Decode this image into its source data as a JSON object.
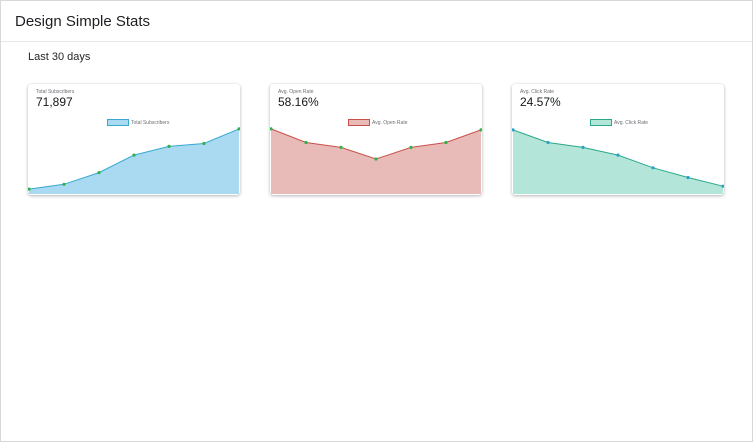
{
  "header": {
    "title": "Design Simple Stats"
  },
  "range_label": "Last 30 days",
  "cards": [
    {
      "label": "Total Subscribers",
      "value": "71,897",
      "legend": "Total Subscribers",
      "fill": "#a9daf2",
      "stroke": "#38a8cf",
      "point": "#2db34a"
    },
    {
      "label": "Avg. Open Rate",
      "value": "58.16%",
      "legend": "Avg. Open Rate",
      "fill": "#e9bbb8",
      "stroke": "#c9504a",
      "point": "#2db34a"
    },
    {
      "label": "Avg. Click Rate",
      "value": "24.57%",
      "legend": "Avg. Click Rate",
      "fill": "#b3e5d9",
      "stroke": "#2aa88b",
      "point": "#2aa1c8"
    }
  ],
  "chart_data": [
    {
      "type": "area",
      "series": [
        {
          "name": "Total Subscribers",
          "values": [
            5,
            10,
            22,
            40,
            49,
            52,
            67
          ]
        }
      ]
    },
    {
      "type": "area",
      "series": [
        {
          "name": "Avg. Open Rate",
          "values": [
            67,
            53,
            48,
            36,
            48,
            53,
            66
          ]
        }
      ]
    },
    {
      "type": "area",
      "series": [
        {
          "name": "Avg. Click Rate",
          "values": [
            66,
            53,
            48,
            40,
            27,
            17,
            8
          ]
        }
      ]
    }
  ]
}
